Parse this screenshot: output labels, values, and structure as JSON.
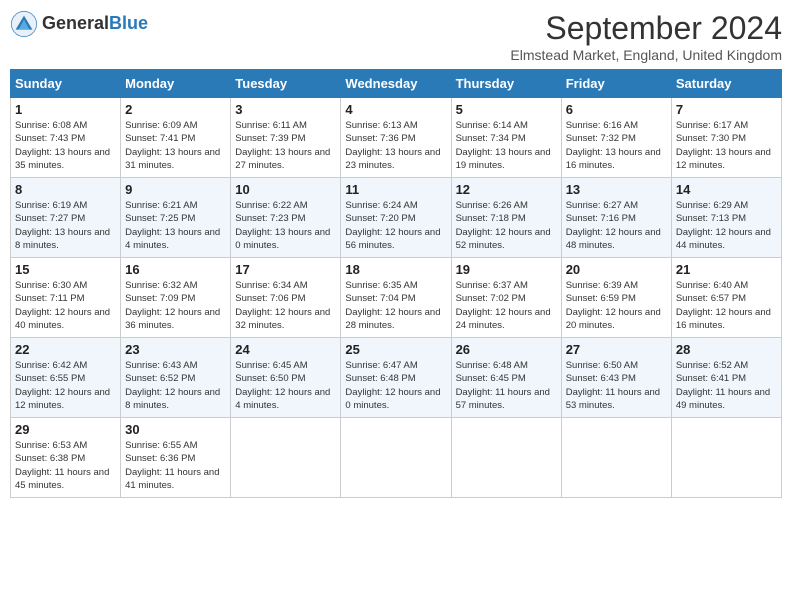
{
  "header": {
    "logo_general": "General",
    "logo_blue": "Blue",
    "month_title": "September 2024",
    "location": "Elmstead Market, England, United Kingdom"
  },
  "weekdays": [
    "Sunday",
    "Monday",
    "Tuesday",
    "Wednesday",
    "Thursday",
    "Friday",
    "Saturday"
  ],
  "weeks": [
    [
      {
        "day": "1",
        "sunrise": "Sunrise: 6:08 AM",
        "sunset": "Sunset: 7:43 PM",
        "daylight": "Daylight: 13 hours and 35 minutes."
      },
      {
        "day": "2",
        "sunrise": "Sunrise: 6:09 AM",
        "sunset": "Sunset: 7:41 PM",
        "daylight": "Daylight: 13 hours and 31 minutes."
      },
      {
        "day": "3",
        "sunrise": "Sunrise: 6:11 AM",
        "sunset": "Sunset: 7:39 PM",
        "daylight": "Daylight: 13 hours and 27 minutes."
      },
      {
        "day": "4",
        "sunrise": "Sunrise: 6:13 AM",
        "sunset": "Sunset: 7:36 PM",
        "daylight": "Daylight: 13 hours and 23 minutes."
      },
      {
        "day": "5",
        "sunrise": "Sunrise: 6:14 AM",
        "sunset": "Sunset: 7:34 PM",
        "daylight": "Daylight: 13 hours and 19 minutes."
      },
      {
        "day": "6",
        "sunrise": "Sunrise: 6:16 AM",
        "sunset": "Sunset: 7:32 PM",
        "daylight": "Daylight: 13 hours and 16 minutes."
      },
      {
        "day": "7",
        "sunrise": "Sunrise: 6:17 AM",
        "sunset": "Sunset: 7:30 PM",
        "daylight": "Daylight: 13 hours and 12 minutes."
      }
    ],
    [
      {
        "day": "8",
        "sunrise": "Sunrise: 6:19 AM",
        "sunset": "Sunset: 7:27 PM",
        "daylight": "Daylight: 13 hours and 8 minutes."
      },
      {
        "day": "9",
        "sunrise": "Sunrise: 6:21 AM",
        "sunset": "Sunset: 7:25 PM",
        "daylight": "Daylight: 13 hours and 4 minutes."
      },
      {
        "day": "10",
        "sunrise": "Sunrise: 6:22 AM",
        "sunset": "Sunset: 7:23 PM",
        "daylight": "Daylight: 13 hours and 0 minutes."
      },
      {
        "day": "11",
        "sunrise": "Sunrise: 6:24 AM",
        "sunset": "Sunset: 7:20 PM",
        "daylight": "Daylight: 12 hours and 56 minutes."
      },
      {
        "day": "12",
        "sunrise": "Sunrise: 6:26 AM",
        "sunset": "Sunset: 7:18 PM",
        "daylight": "Daylight: 12 hours and 52 minutes."
      },
      {
        "day": "13",
        "sunrise": "Sunrise: 6:27 AM",
        "sunset": "Sunset: 7:16 PM",
        "daylight": "Daylight: 12 hours and 48 minutes."
      },
      {
        "day": "14",
        "sunrise": "Sunrise: 6:29 AM",
        "sunset": "Sunset: 7:13 PM",
        "daylight": "Daylight: 12 hours and 44 minutes."
      }
    ],
    [
      {
        "day": "15",
        "sunrise": "Sunrise: 6:30 AM",
        "sunset": "Sunset: 7:11 PM",
        "daylight": "Daylight: 12 hours and 40 minutes."
      },
      {
        "day": "16",
        "sunrise": "Sunrise: 6:32 AM",
        "sunset": "Sunset: 7:09 PM",
        "daylight": "Daylight: 12 hours and 36 minutes."
      },
      {
        "day": "17",
        "sunrise": "Sunrise: 6:34 AM",
        "sunset": "Sunset: 7:06 PM",
        "daylight": "Daylight: 12 hours and 32 minutes."
      },
      {
        "day": "18",
        "sunrise": "Sunrise: 6:35 AM",
        "sunset": "Sunset: 7:04 PM",
        "daylight": "Daylight: 12 hours and 28 minutes."
      },
      {
        "day": "19",
        "sunrise": "Sunrise: 6:37 AM",
        "sunset": "Sunset: 7:02 PM",
        "daylight": "Daylight: 12 hours and 24 minutes."
      },
      {
        "day": "20",
        "sunrise": "Sunrise: 6:39 AM",
        "sunset": "Sunset: 6:59 PM",
        "daylight": "Daylight: 12 hours and 20 minutes."
      },
      {
        "day": "21",
        "sunrise": "Sunrise: 6:40 AM",
        "sunset": "Sunset: 6:57 PM",
        "daylight": "Daylight: 12 hours and 16 minutes."
      }
    ],
    [
      {
        "day": "22",
        "sunrise": "Sunrise: 6:42 AM",
        "sunset": "Sunset: 6:55 PM",
        "daylight": "Daylight: 12 hours and 12 minutes."
      },
      {
        "day": "23",
        "sunrise": "Sunrise: 6:43 AM",
        "sunset": "Sunset: 6:52 PM",
        "daylight": "Daylight: 12 hours and 8 minutes."
      },
      {
        "day": "24",
        "sunrise": "Sunrise: 6:45 AM",
        "sunset": "Sunset: 6:50 PM",
        "daylight": "Daylight: 12 hours and 4 minutes."
      },
      {
        "day": "25",
        "sunrise": "Sunrise: 6:47 AM",
        "sunset": "Sunset: 6:48 PM",
        "daylight": "Daylight: 12 hours and 0 minutes."
      },
      {
        "day": "26",
        "sunrise": "Sunrise: 6:48 AM",
        "sunset": "Sunset: 6:45 PM",
        "daylight": "Daylight: 11 hours and 57 minutes."
      },
      {
        "day": "27",
        "sunrise": "Sunrise: 6:50 AM",
        "sunset": "Sunset: 6:43 PM",
        "daylight": "Daylight: 11 hours and 53 minutes."
      },
      {
        "day": "28",
        "sunrise": "Sunrise: 6:52 AM",
        "sunset": "Sunset: 6:41 PM",
        "daylight": "Daylight: 11 hours and 49 minutes."
      }
    ],
    [
      {
        "day": "29",
        "sunrise": "Sunrise: 6:53 AM",
        "sunset": "Sunset: 6:38 PM",
        "daylight": "Daylight: 11 hours and 45 minutes."
      },
      {
        "day": "30",
        "sunrise": "Sunrise: 6:55 AM",
        "sunset": "Sunset: 6:36 PM",
        "daylight": "Daylight: 11 hours and 41 minutes."
      },
      null,
      null,
      null,
      null,
      null
    ]
  ]
}
